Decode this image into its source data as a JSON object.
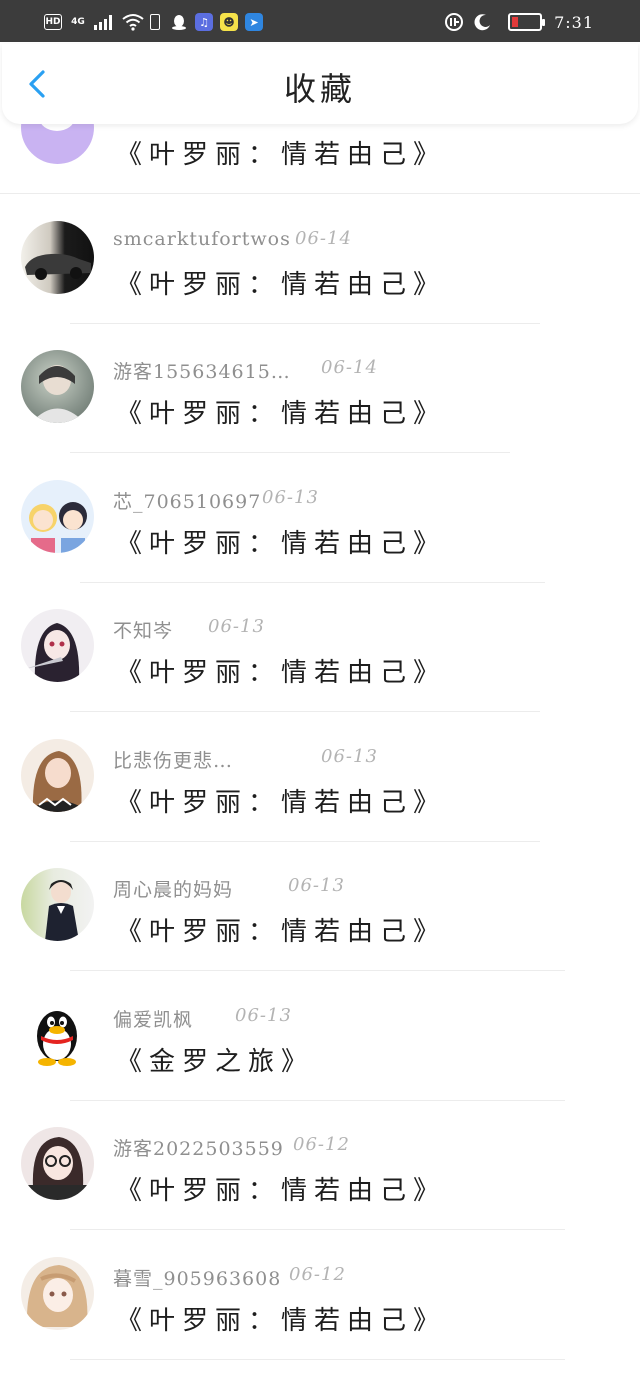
{
  "status_bar": {
    "hd": "HD",
    "network": "4G",
    "time": "7:31",
    "battery_level": 0.22
  },
  "header": {
    "title": "收藏"
  },
  "favorites": [
    {
      "username": "",
      "date": "",
      "book": "《叶罗丽：情若由己》"
    },
    {
      "username": "smcarktufortwos",
      "date": "06-14",
      "book": "《叶罗丽：情若由己》"
    },
    {
      "username": "游客155634615…",
      "date": "06-14",
      "book": "《叶罗丽：情若由己》"
    },
    {
      "username": "芯_706510697",
      "date": "06-13",
      "book": "《叶罗丽：情若由己》"
    },
    {
      "username": "不知岑",
      "date": "06-13",
      "book": "《叶罗丽：情若由己》"
    },
    {
      "username": "比悲伤更悲…",
      "date": "06-13",
      "book": "《叶罗丽：情若由己》"
    },
    {
      "username": "周心晨的妈妈",
      "date": "06-13",
      "book": "《叶罗丽：情若由己》"
    },
    {
      "username": "偏爱凯枫",
      "date": "06-13",
      "book": "《金罗之旅》"
    },
    {
      "username": "游客2022503559",
      "date": "06-12",
      "book": "《叶罗丽：情若由己》"
    },
    {
      "username": "暮雪_905963608",
      "date": "06-12",
      "book": "《叶罗丽：情若由己》"
    }
  ]
}
